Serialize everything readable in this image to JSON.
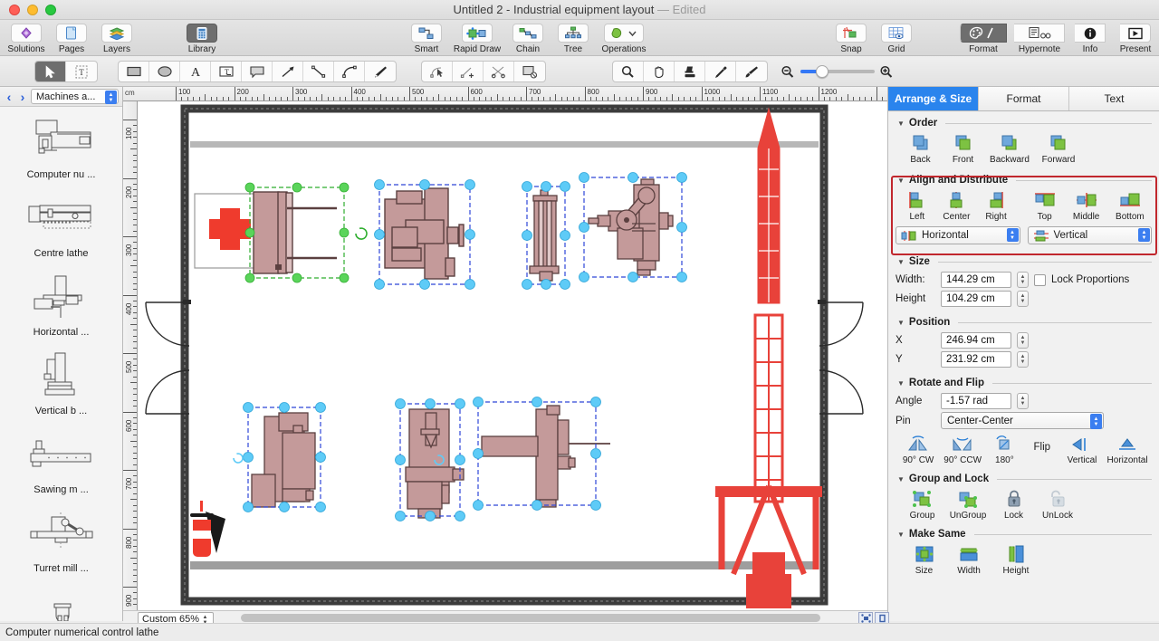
{
  "window": {
    "title": "Untitled 2 - Industrial equipment layout",
    "edited_label": "— Edited"
  },
  "toolbar": {
    "left_group": [
      {
        "label": "Solutions",
        "icon": "solutions-icon"
      },
      {
        "label": "Pages",
        "icon": "pages-icon"
      },
      {
        "label": "Layers",
        "icon": "layers-icon"
      }
    ],
    "library": {
      "label": "Library",
      "icon": "library-icon",
      "active": true
    },
    "center_group": [
      {
        "label": "Smart",
        "icon": "smart-connector-icon"
      },
      {
        "label": "Rapid Draw",
        "icon": "rapid-draw-icon"
      },
      {
        "label": "Chain",
        "icon": "chain-icon"
      },
      {
        "label": "Tree",
        "icon": "tree-icon"
      },
      {
        "label": "Operations",
        "icon": "operations-icon"
      }
    ],
    "view_group": [
      {
        "label": "Snap",
        "icon": "snap-icon"
      },
      {
        "label": "Grid",
        "icon": "grid-icon"
      }
    ],
    "right_group": [
      {
        "label": "Format",
        "icon": "format-palette-icon",
        "active": true
      },
      {
        "label": "Hypernote",
        "icon": "hypernote-icon"
      },
      {
        "label": "Info",
        "icon": "info-icon"
      },
      {
        "label": "Present",
        "icon": "present-icon"
      }
    ]
  },
  "tools": {
    "select_group": [
      {
        "name": "pointer-tool",
        "active": true
      },
      {
        "name": "text-select-tool",
        "active": false
      }
    ],
    "shape_group": [
      "rectangle-tool",
      "ellipse-tool",
      "text-tool",
      "text-box-tool",
      "callout-tool",
      "arrow-tool",
      "line-tool",
      "curve-tool",
      "pen-tool"
    ],
    "edit_group": [
      "node-edit-tool",
      "add-node-tool",
      "cut-path-tool",
      "mask-tool"
    ],
    "view_tools": [
      "zoom-tool",
      "hand-tool",
      "stamp-tool",
      "eyedropper-tool",
      "paintbrush-tool"
    ],
    "zoom_slider": {
      "min_icon": "zoom-out-icon",
      "max_icon": "zoom-in-icon",
      "value": 25
    }
  },
  "library": {
    "nav_back": "‹",
    "nav_forward": "›",
    "category": "Machines a...",
    "items": [
      {
        "label": "Computer nu ...",
        "icon": "cnc-lathe-shape"
      },
      {
        "label": "Centre lathe",
        "icon": "centre-lathe-shape"
      },
      {
        "label": "Horizontal ...",
        "icon": "horizontal-mill-shape"
      },
      {
        "label": "Vertical b ...",
        "icon": "vertical-borer-shape"
      },
      {
        "label": "Sawing m ...",
        "icon": "sawing-machine-shape"
      },
      {
        "label": "Turret mill ...",
        "icon": "turret-mill-shape"
      }
    ]
  },
  "canvas": {
    "ruler_unit": "cm",
    "h_ruler_ticks": [
      "100",
      "200",
      "300",
      "400",
      "500",
      "600",
      "700",
      "800",
      "900",
      "1000",
      "1100",
      "1200"
    ],
    "v_ruler_ticks": [
      "100",
      "200",
      "300",
      "400",
      "500",
      "600",
      "700",
      "800",
      "900"
    ]
  },
  "inspector": {
    "tabs": [
      {
        "label": "Arrange & Size",
        "active": true
      },
      {
        "label": "Format",
        "active": false
      },
      {
        "label": "Text",
        "active": false
      }
    ],
    "order": {
      "title": "Order",
      "buttons": [
        {
          "label": "Back",
          "icon": "send-to-back-icon"
        },
        {
          "label": "Front",
          "icon": "bring-to-front-icon"
        },
        {
          "label": "Backward",
          "icon": "send-backward-icon"
        },
        {
          "label": "Forward",
          "icon": "bring-forward-icon"
        }
      ]
    },
    "align": {
      "title": "Align and Distribute",
      "highlighted": true,
      "highlight_color": "#c1272d",
      "buttons": [
        {
          "label": "Left",
          "icon": "align-left-icon"
        },
        {
          "label": "Center",
          "icon": "align-center-icon"
        },
        {
          "label": "Right",
          "icon": "align-right-icon"
        },
        {
          "label": "Top",
          "icon": "align-top-icon"
        },
        {
          "label": "Middle",
          "icon": "align-middle-icon"
        },
        {
          "label": "Bottom",
          "icon": "align-bottom-icon"
        }
      ],
      "distribute_horizontal": "Horizontal",
      "distribute_vertical": "Vertical"
    },
    "size": {
      "title": "Size",
      "width_label": "Width:",
      "width_value": "144.29 cm",
      "height_label": "Height",
      "height_value": "104.29 cm",
      "lock_proportions_label": "Lock Proportions",
      "lock_proportions_checked": false
    },
    "position": {
      "title": "Position",
      "x_label": "X",
      "x_value": "246.94 cm",
      "y_label": "Y",
      "y_value": "231.92 cm"
    },
    "rotate": {
      "title": "Rotate and Flip",
      "angle_label": "Angle",
      "angle_value": "-1.57 rad",
      "pin_label": "Pin",
      "pin_value": "Center-Center",
      "buttons": [
        {
          "label": "90° CW",
          "icon": "rotate-cw-icon"
        },
        {
          "label": "90° CCW",
          "icon": "rotate-ccw-icon"
        },
        {
          "label": "180°",
          "icon": "rotate-180-icon"
        },
        {
          "label": "Flip",
          "icon": "flip-label"
        },
        {
          "label": "Vertical",
          "icon": "flip-vertical-icon"
        },
        {
          "label": "Horizontal",
          "icon": "flip-horizontal-icon"
        }
      ]
    },
    "group": {
      "title": "Group and Lock",
      "buttons": [
        {
          "label": "Group",
          "icon": "group-icon"
        },
        {
          "label": "UnGroup",
          "icon": "ungroup-icon"
        },
        {
          "label": "Lock",
          "icon": "lock-icon"
        },
        {
          "label": "UnLock",
          "icon": "unlock-icon"
        }
      ]
    },
    "make_same": {
      "title": "Make Same",
      "buttons": [
        {
          "label": "Size",
          "icon": "same-size-icon"
        },
        {
          "label": "Width",
          "icon": "same-width-icon"
        },
        {
          "label": "Height",
          "icon": "same-height-icon"
        }
      ]
    }
  },
  "statusbar": {
    "message": "Computer numerical control lathe",
    "zoom_value": "Custom 65%"
  },
  "colors": {
    "accent": "#2a84ed",
    "highlight": "#c1272d",
    "machine_fill": "#c49a9a",
    "machine_stroke": "#5b4040",
    "crane_red": "#e8423a",
    "handle_primary": "#4fd04f",
    "handle_secondary": "#4cc6f5",
    "selection_dash": "#2e46d8"
  }
}
